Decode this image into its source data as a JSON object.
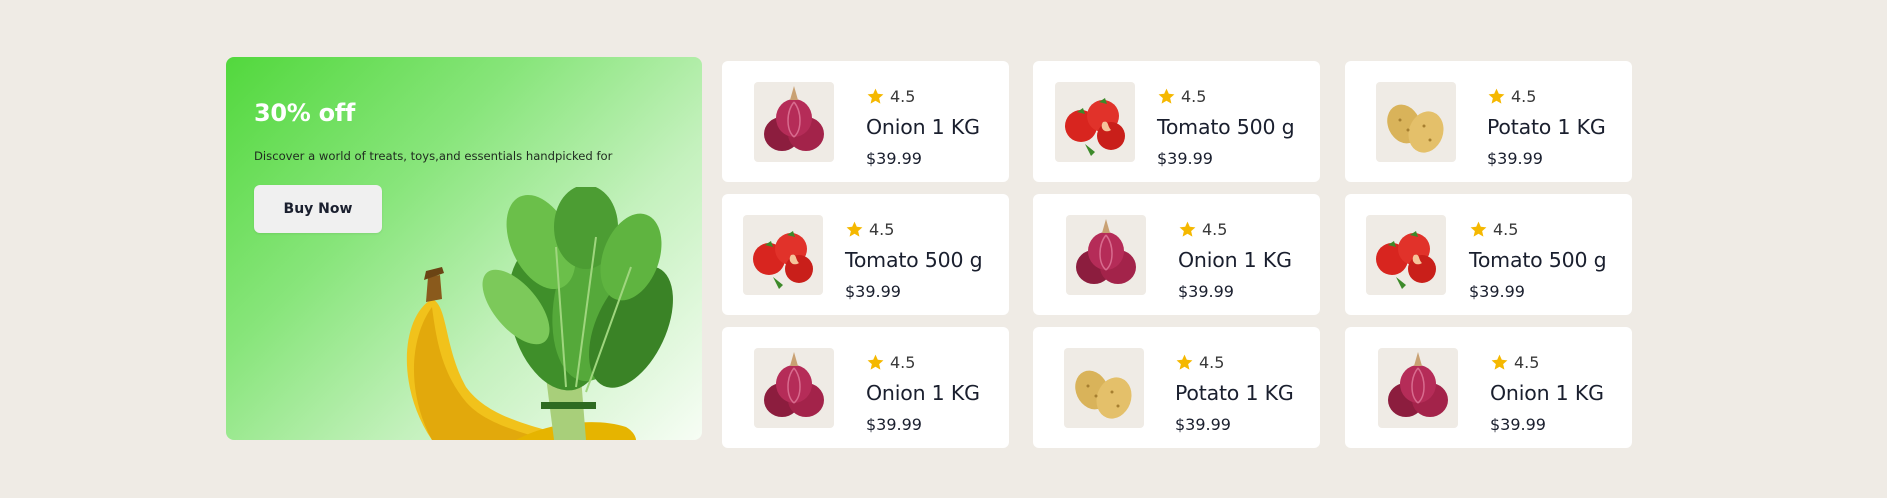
{
  "promo": {
    "title": "30% off",
    "description": "Discover a world of treats, toys,and essentials handpicked for",
    "button_label": "Buy Now"
  },
  "products": [
    {
      "rating": "4.5",
      "name": "Onion 1 KG",
      "price": "$39.99",
      "image": "onion"
    },
    {
      "rating": "4.5",
      "name": "Tomato 500 g",
      "price": "$39.99",
      "image": "tomato"
    },
    {
      "rating": "4.5",
      "name": "Potato 1 KG",
      "price": "$39.99",
      "image": "potato"
    },
    {
      "rating": "4.5",
      "name": "Tomato 500 g",
      "price": "$39.99",
      "image": "tomato"
    },
    {
      "rating": "4.5",
      "name": "Onion 1 KG",
      "price": "$39.99",
      "image": "onion"
    },
    {
      "rating": "4.5",
      "name": "Tomato 500 g",
      "price": "$39.99",
      "image": "tomato"
    },
    {
      "rating": "4.5",
      "name": "Onion 1 KG",
      "price": "$39.99",
      "image": "onion"
    },
    {
      "rating": "4.5",
      "name": "Potato 1 KG",
      "price": "$39.99",
      "image": "potato"
    },
    {
      "rating": "4.5",
      "name": "Onion 1 KG",
      "price": "$39.99",
      "image": "onion"
    }
  ],
  "colors": {
    "background": "#efebe5",
    "promo_green": "#52d83d",
    "star": "#f5b800",
    "text_dark": "#1a1f2e"
  }
}
